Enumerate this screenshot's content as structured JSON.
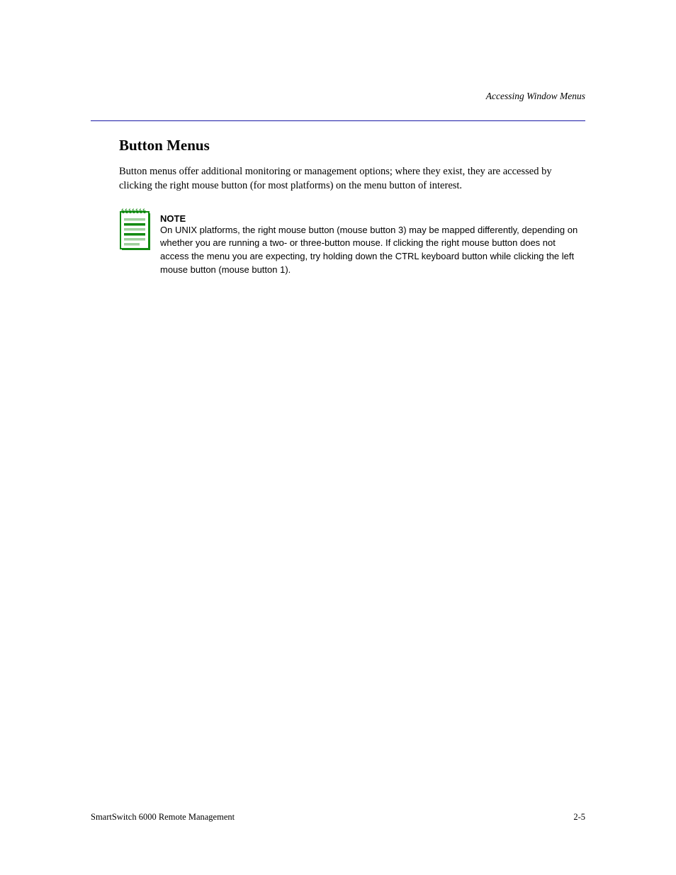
{
  "header": {
    "section_title": "Accessing Window Menus"
  },
  "main": {
    "heading": "Button Menus",
    "paragraph": "Button menus offer additional monitoring or management options; where they exist, they are accessed by clicking the right mouse button (for most platforms) on the menu button of interest.",
    "note": {
      "label": "NOTE",
      "body": "On UNIX platforms, the right mouse button (mouse button 3) may be mapped differently, depending on whether you are running a two- or three-button mouse. If clicking the right mouse button does not access the menu you are expecting, try holding down the CTRL keyboard button while clicking the left mouse button (mouse button 1)."
    }
  },
  "footer": {
    "left": "SmartSwitch 6000 Remote Management",
    "right": "2-5"
  },
  "colors": {
    "divider": "#1a1aa6",
    "note_icon_green": "#118a11",
    "note_icon_light": "#9fd09d"
  }
}
